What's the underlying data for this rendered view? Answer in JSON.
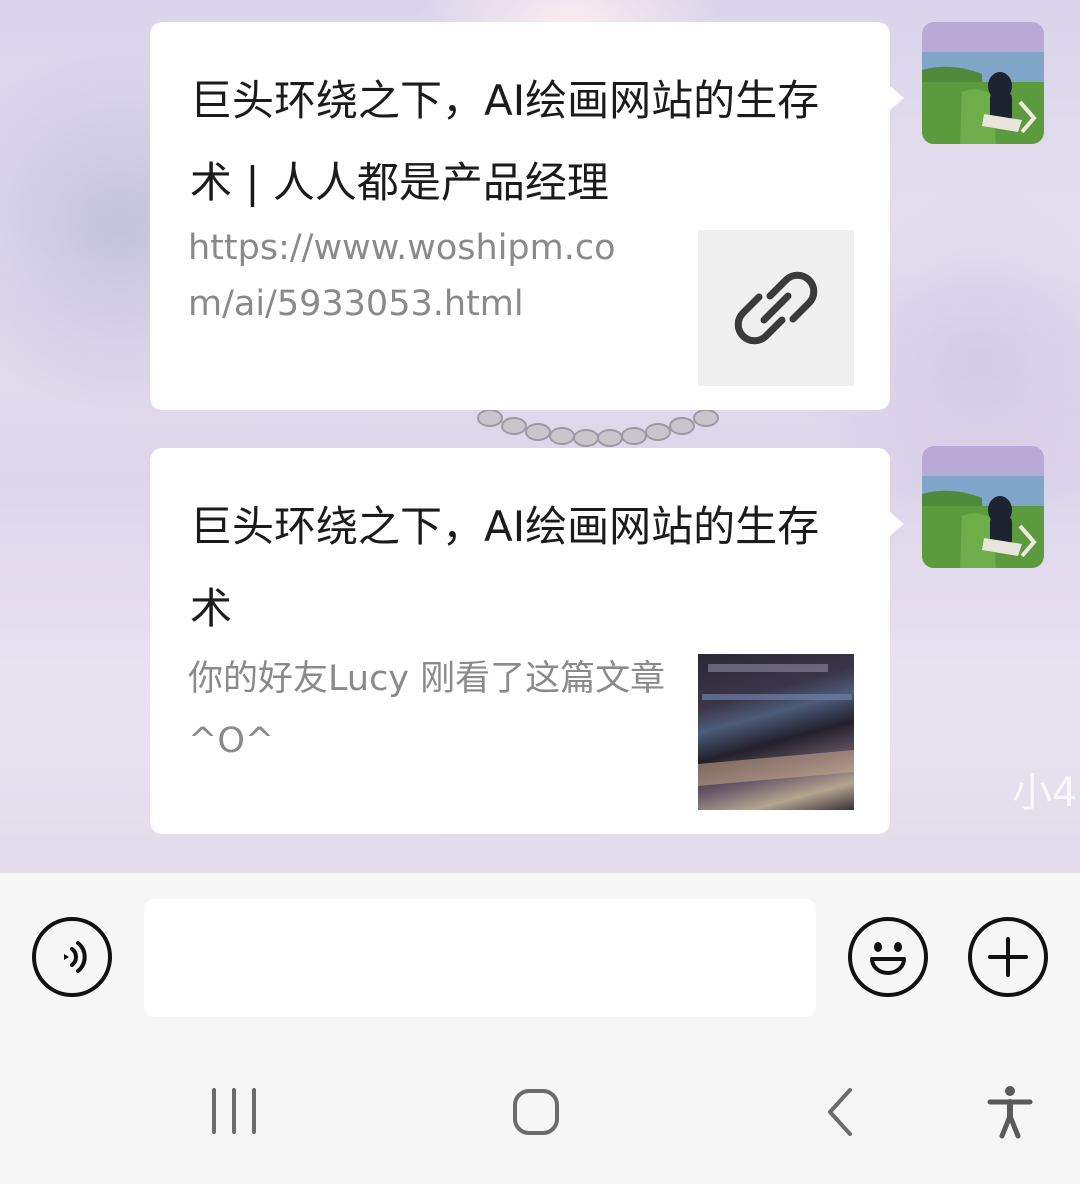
{
  "messages": [
    {
      "title": "巨头环绕之下，AI绘画网站的生存术 | 人人都是产品经理",
      "description": "https://www.woshipm.com/ai/5933053.html",
      "thumbnail_icon": "link-icon"
    },
    {
      "title": "巨头环绕之下，AI绘画网站的生存术",
      "description": "你的好友Lucy 刚看了这篇文章^O^",
      "thumbnail_icon": "article-image"
    }
  ],
  "background": {
    "watermark": "小4"
  },
  "input_bar": {
    "voice_icon": "voice-icon",
    "message_value": "",
    "emoji_icon": "emoji-icon",
    "plus_icon": "plus-icon"
  },
  "nav_bar": {
    "recent_icon": "recent-apps-icon",
    "home_icon": "home-icon",
    "back_icon": "back-icon",
    "accessibility_icon": "accessibility-icon"
  },
  "colors": {
    "bubble": "#ffffff",
    "title_text": "#1b1b1b",
    "desc_text": "#8a8a8a",
    "icon_stroke": "#111111",
    "bar_bg": "#f6f6f6"
  }
}
